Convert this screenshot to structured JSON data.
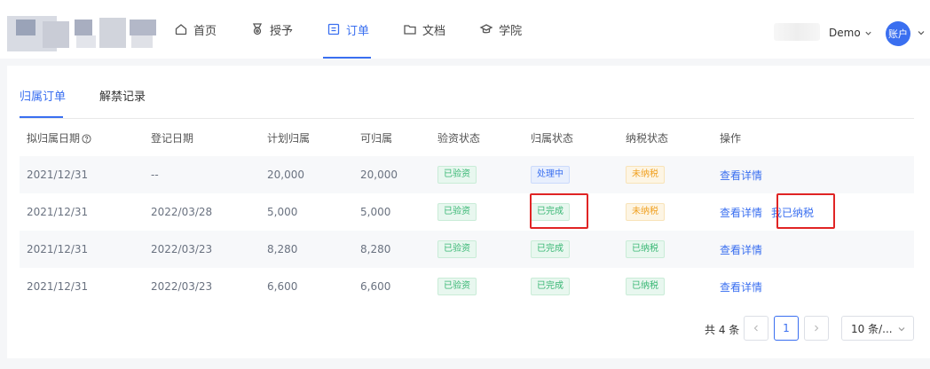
{
  "nav": {
    "items": [
      {
        "label": "首页",
        "icon": "home-icon",
        "active": false
      },
      {
        "label": "授予",
        "icon": "medal-icon",
        "active": false
      },
      {
        "label": "订单",
        "icon": "order-icon",
        "active": true
      },
      {
        "label": "文档",
        "icon": "folder-icon",
        "active": false
      },
      {
        "label": "学院",
        "icon": "graduation-icon",
        "active": false
      }
    ],
    "env_label": "Demo",
    "avatar_text": "账户"
  },
  "tabs": [
    {
      "label": "归属订单",
      "active": true
    },
    {
      "label": "解禁记录",
      "active": false
    }
  ],
  "table": {
    "headers": [
      "拟归属日期",
      "登记日期",
      "计划归属",
      "可归属",
      "验资状态",
      "归属状态",
      "纳税状态",
      "操作"
    ],
    "rows": [
      {
        "vest_date": "2021/12/31",
        "reg_date": "--",
        "planned": "20,000",
        "vestable": "20,000",
        "capital": "已验资",
        "vest_status": "处理中",
        "vest_color": "blue",
        "tax": "未纳税",
        "tax_color": "orange",
        "action1": "查看详情",
        "action2": ""
      },
      {
        "vest_date": "2021/12/31",
        "reg_date": "2022/03/28",
        "planned": "5,000",
        "vestable": "5,000",
        "capital": "已验资",
        "vest_status": "已完成",
        "vest_color": "green",
        "tax": "未纳税",
        "tax_color": "orange",
        "action1": "查看详情",
        "action2": "我已纳税"
      },
      {
        "vest_date": "2021/12/31",
        "reg_date": "2022/03/23",
        "planned": "8,280",
        "vestable": "8,280",
        "capital": "已验资",
        "vest_status": "已完成",
        "vest_color": "green",
        "tax": "已纳税",
        "tax_color": "green",
        "action1": "查看详情",
        "action2": ""
      },
      {
        "vest_date": "2021/12/31",
        "reg_date": "2022/03/23",
        "planned": "6,600",
        "vestable": "6,600",
        "capital": "已验资",
        "vest_status": "已完成",
        "vest_color": "green",
        "tax": "已纳税",
        "tax_color": "green",
        "action1": "查看详情",
        "action2": ""
      }
    ]
  },
  "pagination": {
    "total": "共 4 条",
    "current": "1",
    "page_size": "10 条/..."
  },
  "colors": {
    "accent": "#3a6ff0",
    "highlight": "#e02424"
  }
}
